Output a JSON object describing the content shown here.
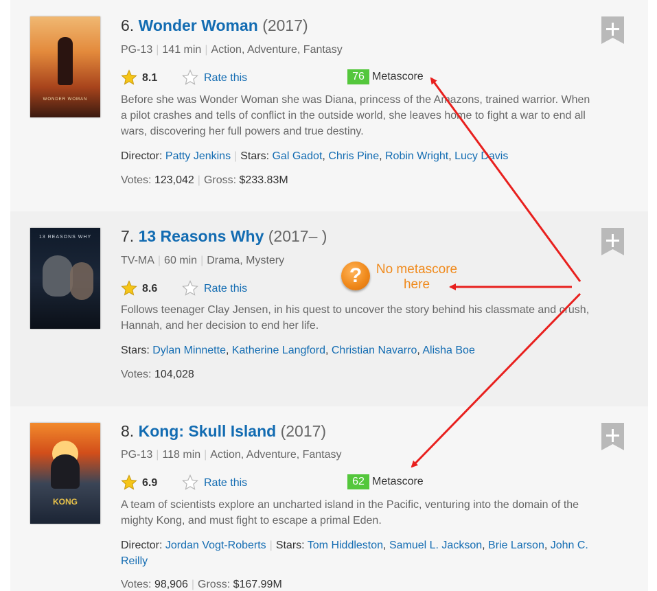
{
  "items": [
    {
      "rank": "6.",
      "title": "Wonder Woman",
      "year": "(2017)",
      "certificate": "PG-13",
      "runtime": "141 min",
      "genres": "Action, Adventure, Fantasy",
      "rating": "8.1",
      "rate_label": "Rate this",
      "metascore": "76",
      "metascore_label": "Metascore",
      "plot_lines": [
        "Before she was Wonder Woman she was Diana, princess of the Amazons, trained warrior. When",
        "a pilot crashes and tells of conflict in the outside world, she leaves home to fight a war to end all",
        "wars, discovering her full powers and true destiny."
      ],
      "director_label": "Director:",
      "director": "Patty Jenkins",
      "stars_label": "Stars:",
      "stars": [
        "Gal Gadot",
        "Chris Pine",
        "Robin Wright",
        "Lucy Davis"
      ],
      "votes_label": "Votes:",
      "votes": "123,042",
      "gross_label": "Gross:",
      "gross": "$233.83M",
      "poster_text": "WONDER WOMAN"
    },
    {
      "rank": "7.",
      "title": "13 Reasons Why",
      "year": "(2017– )",
      "certificate": "TV-MA",
      "runtime": "60 min",
      "genres": "Drama, Mystery",
      "rating": "8.6",
      "rate_label": "Rate this",
      "plot_lines": [
        "Follows teenager Clay Jensen, in his quest to uncover the story behind his classmate and crush,",
        "Hannah, and her decision to end her life."
      ],
      "stars_label": "Stars:",
      "stars": [
        "Dylan Minnette",
        "Katherine Langford",
        "Christian Navarro",
        "Alisha Boe"
      ],
      "votes_label": "Votes:",
      "votes": "104,028",
      "poster_text": "13 REASONS WHY"
    },
    {
      "rank": "8.",
      "title": "Kong: Skull Island",
      "year": "(2017)",
      "certificate": "PG-13",
      "runtime": "118 min",
      "genres": "Action, Adventure, Fantasy",
      "rating": "6.9",
      "rate_label": "Rate this",
      "metascore": "62",
      "metascore_label": "Metascore",
      "plot_lines": [
        "A team of scientists explore an uncharted island in the Pacific, venturing into the domain of the",
        "mighty Kong, and must fight to escape a primal Eden."
      ],
      "director_label": "Director:",
      "director": "Jordan Vogt-Roberts",
      "stars_label": "Stars:",
      "stars": [
        "Tom Hiddleston",
        "Samuel L. Jackson",
        "Brie Larson",
        "John C.",
        "Reilly"
      ],
      "votes_label": "Votes:",
      "votes": "98,906",
      "gross_label": "Gross:",
      "gross": "$167.99M",
      "poster_text": "KONG"
    }
  ],
  "annotation": {
    "icon": "question-mark-icon",
    "icon_glyph": "?",
    "line1": "No metascore",
    "line2": "here"
  },
  "colors": {
    "link": "#136cb2",
    "metascore_green": "#54c73c",
    "annotation_orange": "#f08a1c",
    "arrow_red": "#e8201e"
  }
}
